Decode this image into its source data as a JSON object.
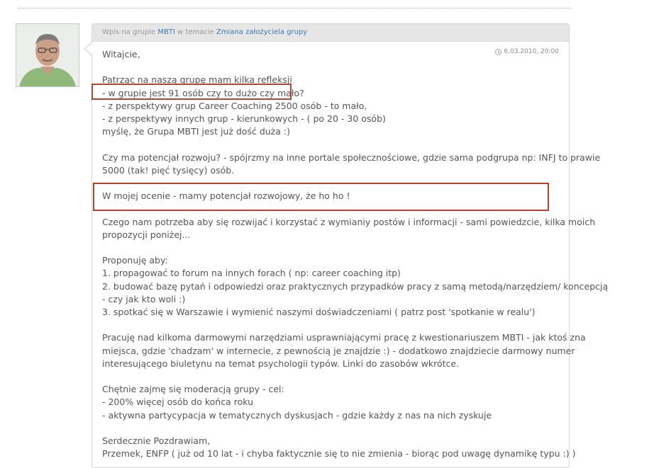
{
  "header": {
    "prefix": "Wpis na grupie",
    "group": "MBTI",
    "middle": "w temacie",
    "topic": "Zmiana założyciela grupy"
  },
  "timestamp": "6.03.2010, 20:00",
  "lines": [
    "Witajcie,",
    "",
    "Patrząc na naszą grupę mam kilka refleksji",
    "- w grupie jest 91 osób czy to dużo czy mało?",
    "- z perspektywy grup Career Coaching 2500 osób - to mało,",
    "- z perspektywy innych grup - kierunkowych - ( po 20 - 30 osób)",
    "myślę, że Grupa MBTI jest już dość duża :)",
    "",
    "Czy ma potencjał rozwoju? - spójrzmy na inne portale społecznościowe, gdzie sama podgrupa np: INFJ to prawie",
    "5000 (tak! pięć tysięcy) osób.",
    "",
    "W mojej ocenie - mamy potencjał rozwojowy, że ho ho !",
    "",
    "Czego nam potrzeba aby się rozwijać i korzystać z wymianiy postów i informacji - sami powiedzcie, kilka moich",
    "propozycji poniżej...",
    "",
    "Proponuję aby:",
    "1. propagować to forum na innych forach ( np: career coaching itp)",
    "2. budować bazę pytań i odpowiedzi oraz praktycznych przypadków pracy z samą metodą/narzędziem/ koncepcją",
    "- czy jak kto woli :)",
    "3. spotkać się w Warszawie i wymienić naszymi doświadczeniami ( patrz post 'spotkanie w realu')",
    "",
    "Pracuję nad kilkoma darmowymi narzędziami usprawniającymi pracę z kwestionariuszem MBTI - jak ktoś zna",
    "miejsca, gdzie 'chadzam' w internecie, z pewnością je znajdzie :) - dodatkowo znajdziecie darmowy numer",
    "interesującego biuletynu na temat psychologii typów. Linki do zasobów wkrótce.",
    "",
    "Chętnie zajmę się moderacją grupy - cel:",
    "- 200% więcej osób do końca roku",
    "- aktywna partycypacja w tematycznych dyskusjach - gdzie każdy z nas na nich zyskuje",
    "",
    "Serdecznie Pozdrawiam,",
    "Przemek, ENFP ( już od 10 lat - i chyba faktycznie się to nie zmienia - biorąc pod uwagę dynamikę typu :) )"
  ],
  "colors": {
    "highlight_border": "#b5432f",
    "link": "#3a7ab8",
    "header_bg": "#e6e6e6"
  }
}
